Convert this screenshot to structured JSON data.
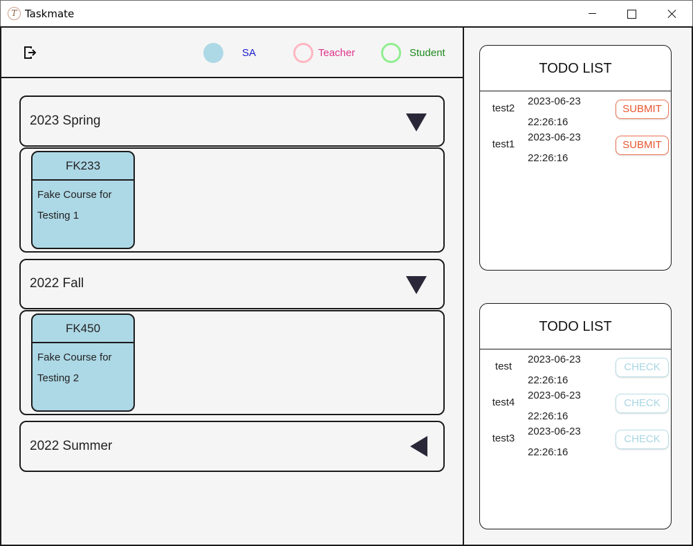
{
  "window": {
    "title": "Taskmate",
    "icon_glyph": "T"
  },
  "header": {
    "legend": {
      "sa": "SA",
      "teacher": "Teacher",
      "student": "Student"
    }
  },
  "colors": {
    "sa": "#add8e6",
    "teacher": "#ffb6c1",
    "student": "#90ee90",
    "sa_text": "#1a1acc",
    "teacher_text": "#e0338a",
    "student_text": "#1e8a1e",
    "submit": "#e8552e",
    "check": "#a8d6e3"
  },
  "semesters": [
    {
      "label": "2023 Spring",
      "expanded": true,
      "courses": [
        {
          "code": "FK233",
          "name": "Fake Course for Testing 1"
        }
      ]
    },
    {
      "label": "2022 Fall",
      "expanded": true,
      "courses": [
        {
          "code": "FK450",
          "name": "Fake Course for Testing 2"
        }
      ]
    },
    {
      "label": "2022 Summer",
      "expanded": false,
      "courses": []
    }
  ],
  "todo_student": {
    "title": "TODO LIST",
    "items": [
      {
        "name": "test2",
        "date": "2023-06-23",
        "time": "22:26:16",
        "action": "SUBMIT"
      },
      {
        "name": "test1",
        "date": "2023-06-23",
        "time": "22:26:16",
        "action": "SUBMIT"
      }
    ]
  },
  "todo_teacher": {
    "title": "TODO LIST",
    "items": [
      {
        "name": "test",
        "date": "2023-06-23",
        "time": "22:26:16",
        "action": "CHECK"
      },
      {
        "name": "test4",
        "date": "2023-06-23",
        "time": "22:26:16",
        "action": "CHECK"
      },
      {
        "name": "test3",
        "date": "2023-06-23",
        "time": "22:26:16",
        "action": "CHECK"
      }
    ]
  }
}
